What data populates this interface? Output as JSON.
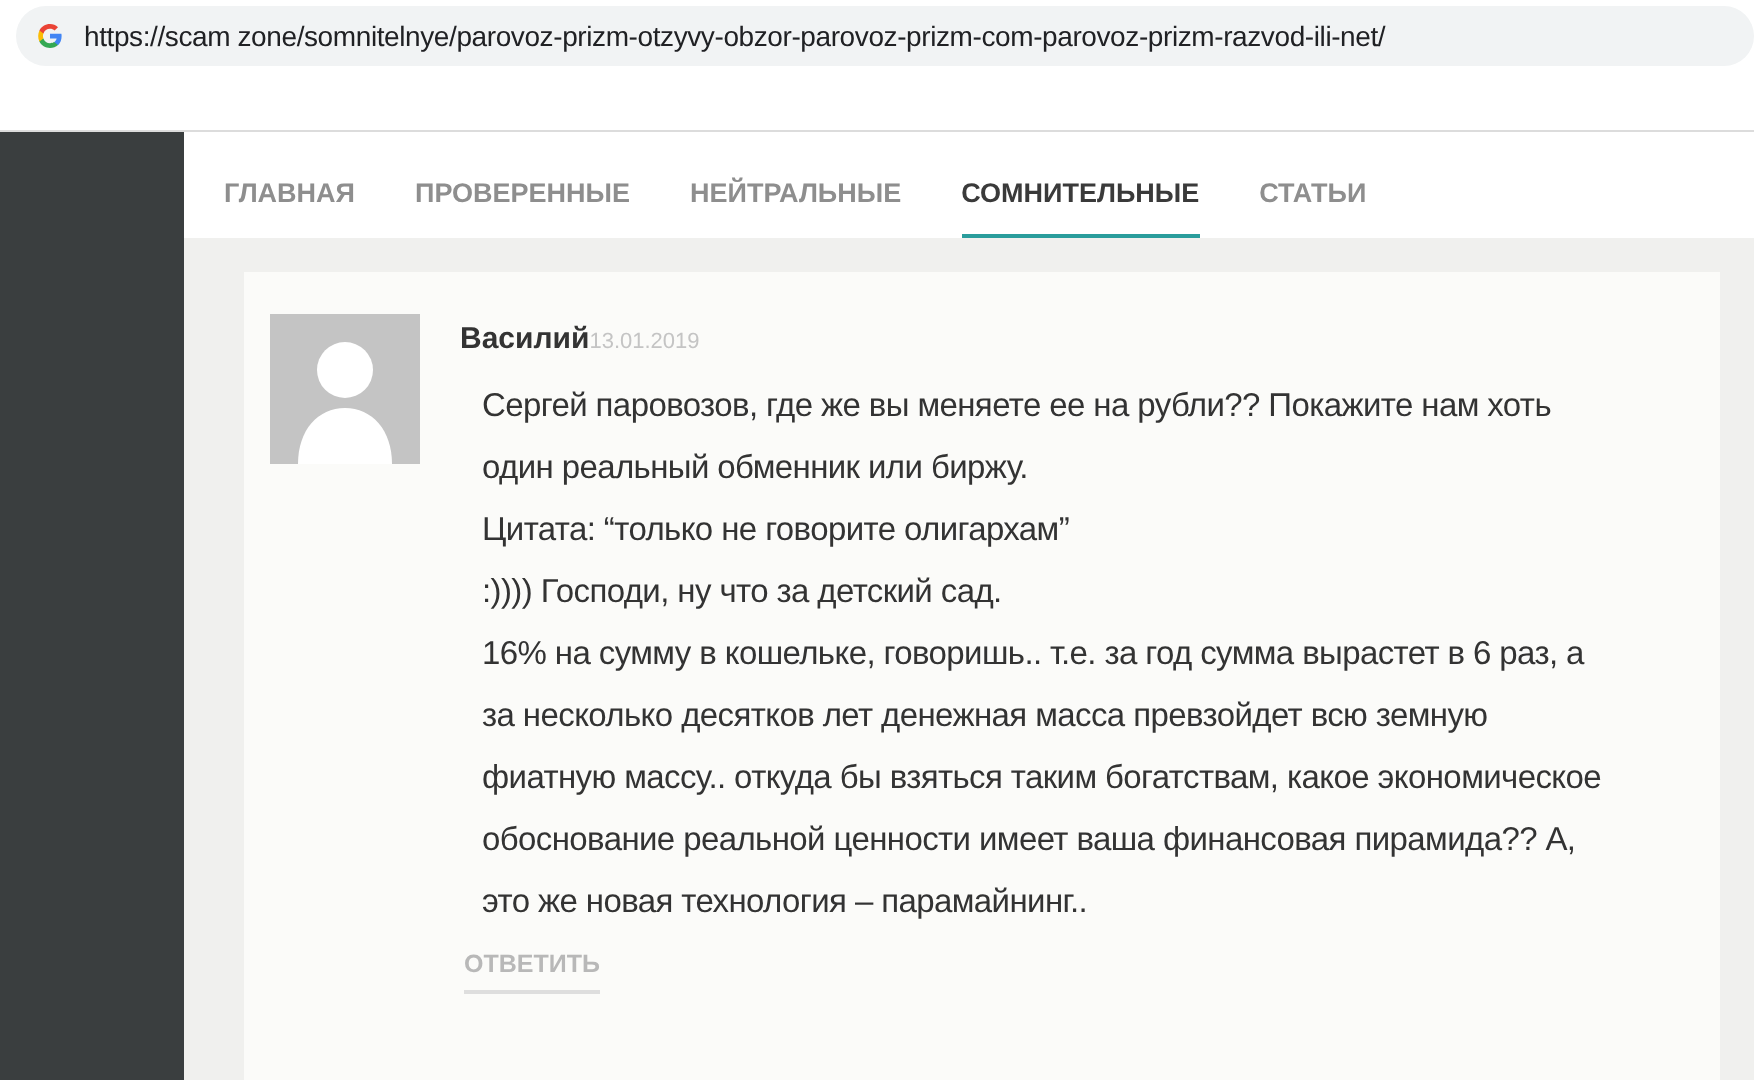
{
  "address_bar": {
    "url": "https://scam zone/somnitelnye/parovoz-prizm-otzyvy-obzor-parovoz-prizm-com-parovoz-prizm-razvod-ili-net/"
  },
  "nav": [
    {
      "label": "ГЛАВНАЯ",
      "selected": false
    },
    {
      "label": "ПРОВЕРЕННЫЕ",
      "selected": false
    },
    {
      "label": "НЕЙТРАЛЬНЫЕ",
      "selected": false
    },
    {
      "label": "СОМНИТЕЛЬНЫЕ",
      "selected": true
    },
    {
      "label": "СТАТЬИ",
      "selected": false
    }
  ],
  "comment": {
    "author": "Василий",
    "date": "13.01.2019",
    "paragraphs": [
      "Сергей паровозов, где же вы меняете ее на рубли?? Покажите нам хоть один реальный обменник или биржу.",
      "Цитата: “только не говорите олигархам”",
      ":)))) Господи, ну что за детский сад.",
      "16% на сумму в кошельке, говоришь.. т.е. за год сумма вырастет в 6 раз, а за несколько десятков лет денежная масса превзойдет всю земную фиатную массу.. откуда бы взяться таким богатствам, какое экономическое обоснование реальной ценности имеет ваша финансовая пирамида?? А, это же новая технология – парамайнинг.."
    ],
    "reply": "ОТВЕТИТЬ"
  }
}
